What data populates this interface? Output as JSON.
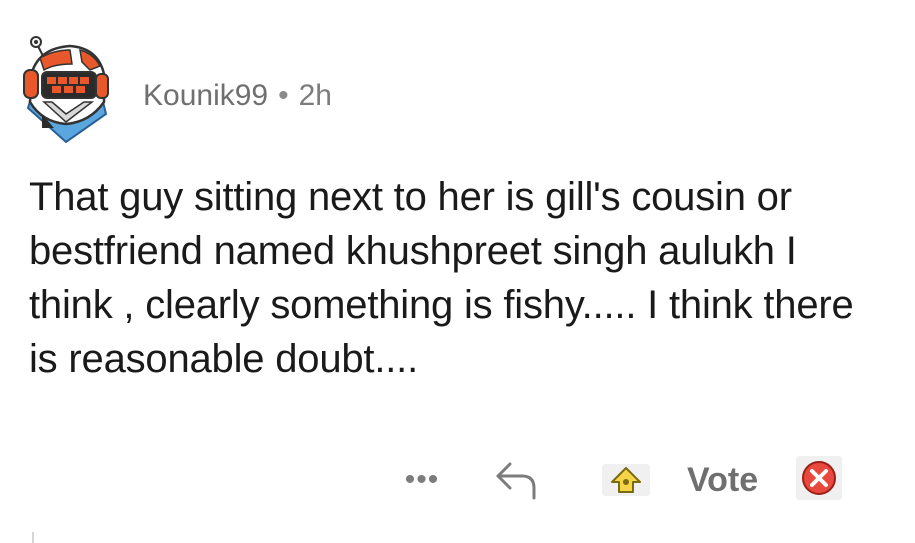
{
  "comment": {
    "username": "Kounik99",
    "separator": "•",
    "time": "2h",
    "body": "That guy sitting next to her is gill's cousin or bestfriend named khushpreet singh aulukh I think , clearly something is fishy..... I think there is reasonable doubt....",
    "avatar_icon": "robot-avatar-icon"
  },
  "actions": {
    "more_label": "•••",
    "more_icon": "more-options-icon",
    "reply_icon": "reply-arrow-icon",
    "upvote_icon": "upvote-award-icon",
    "vote_label": "Vote",
    "downvote_icon": "downvote-x-icon"
  },
  "colors": {
    "text": "#1a1a1b",
    "meta": "#7c7c7c",
    "upvote_yellow": "#f5d44a",
    "downvote_red": "#e8483e",
    "avatar_blue": "#5aa7e0",
    "avatar_orange": "#e8582a"
  }
}
